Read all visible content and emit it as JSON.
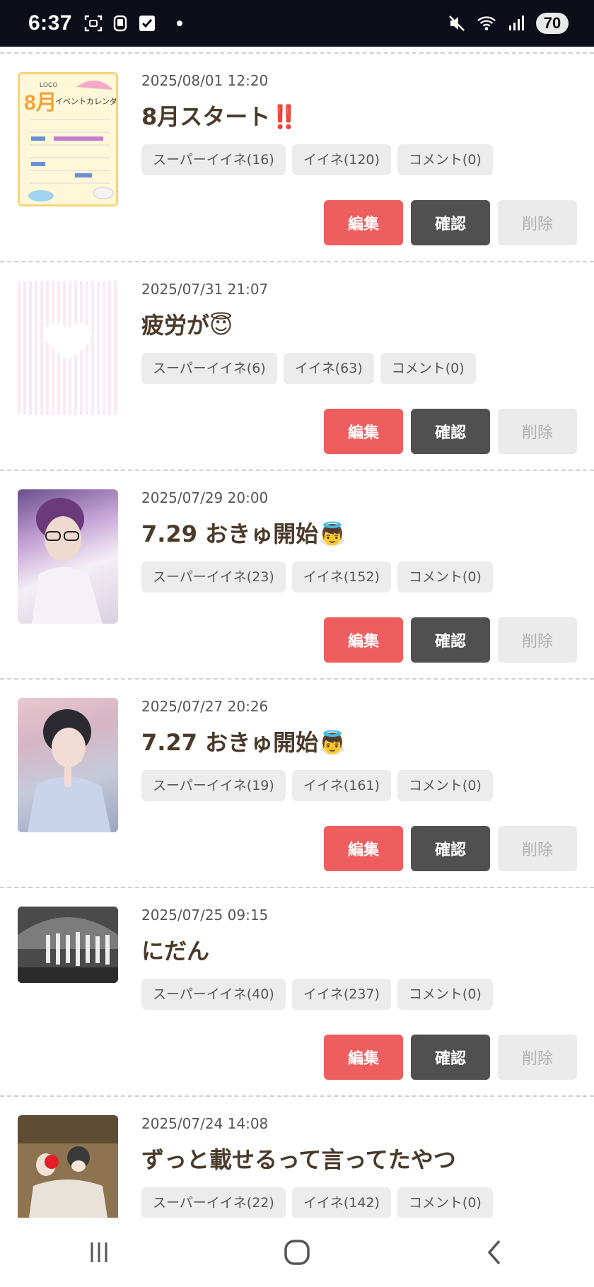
{
  "status_bar": {
    "time": "6:37",
    "battery": "70",
    "icons": [
      "screenshot-icon",
      "bus-icon",
      "checkbox-icon",
      "dot-icon",
      "mute-icon",
      "wifi-icon",
      "signal-icon"
    ]
  },
  "posts": [
    {
      "date": "2025/08/01 12:20",
      "title": "8月スタート‼️",
      "thumb_text": [
        "LOCO",
        "8月",
        "イベントカレンダー"
      ],
      "tags": [
        "スーパーイイネ(16)",
        "イイネ(120)",
        "コメント(0)"
      ]
    },
    {
      "date": "2025/07/31 21:07",
      "title": "疲労が😇",
      "tags": [
        "スーパーイイネ(6)",
        "イイネ(63)",
        "コメント(0)"
      ]
    },
    {
      "date": "2025/07/29 20:00",
      "title": "7.29 おきゅ開始👼",
      "tags": [
        "スーパーイイネ(23)",
        "イイネ(152)",
        "コメント(0)"
      ]
    },
    {
      "date": "2025/07/27 20:26",
      "title": "7.27 おきゅ開始👼",
      "tags": [
        "スーパーイイネ(19)",
        "イイネ(161)",
        "コメント(0)"
      ]
    },
    {
      "date": "2025/07/25 09:15",
      "title": "にだん",
      "tags": [
        "スーパーイイネ(40)",
        "イイネ(237)",
        "コメント(0)"
      ]
    },
    {
      "date": "2025/07/24 14:08",
      "title": "ずっと載せるって言ってたやつ",
      "tags": [
        "スーパーイイネ(22)",
        "イイネ(142)",
        "コメント(0)"
      ]
    }
  ],
  "actions": {
    "edit": "編集",
    "confirm": "確認",
    "delete": "削除"
  },
  "colors": {
    "edit": "#ef5e5e",
    "confirm": "#505050",
    "delete_bg": "#ebebeb",
    "title": "#4a3a2a",
    "status_bar_bg": "#0d0e1a"
  },
  "nav": [
    "recent-apps-icon",
    "home-icon",
    "back-icon"
  ]
}
